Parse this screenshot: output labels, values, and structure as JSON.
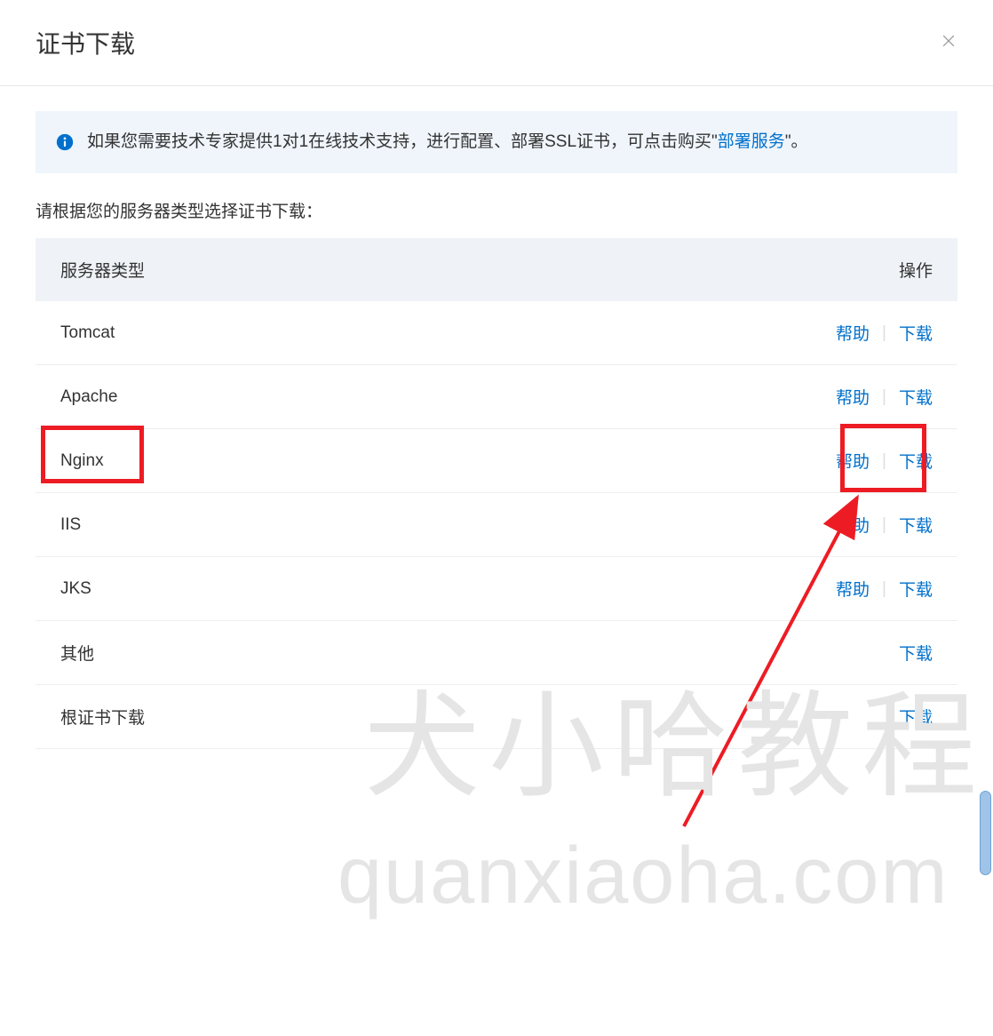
{
  "header": {
    "title": "证书下载"
  },
  "banner": {
    "text_prefix": "如果您需要技术专家提供1对1在线技术支持，进行配置、部署SSL证书，可点击购买\"",
    "link_text": "部署服务",
    "text_suffix": "\"。"
  },
  "subtitle": "请根据您的服务器类型选择证书下载：",
  "table": {
    "header_col1": "服务器类型",
    "header_col2": "操作",
    "action_help": "帮助",
    "action_download": "下载",
    "rows": [
      {
        "name": "Tomcat",
        "has_help": true
      },
      {
        "name": "Apache",
        "has_help": true
      },
      {
        "name": "Nginx",
        "has_help": true
      },
      {
        "name": "IIS",
        "has_help": true
      },
      {
        "name": "JKS",
        "has_help": true
      },
      {
        "name": "其他",
        "has_help": false
      },
      {
        "name": "根证书下载",
        "has_help": false
      }
    ]
  },
  "watermark": {
    "cn": "犬小哈教程",
    "en": "quanxiaoha.com"
  }
}
